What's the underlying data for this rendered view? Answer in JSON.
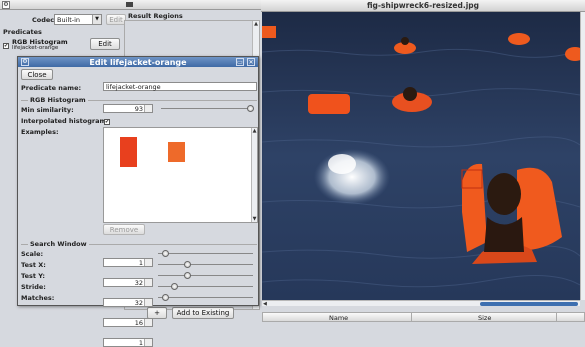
{
  "main_window": {
    "codec_label": "Codec",
    "codec_value": "Built-in",
    "edit_label": "Edit",
    "predicates_heading": "Predicates",
    "predicate_name": "RGB Histogram",
    "predicate_sub": "lifejacket-orange",
    "predicate_edit_label": "Edit",
    "result_regions_label": "Result Regions",
    "add_button_label": "+",
    "add_existing_label": "Add to Existing"
  },
  "dialog": {
    "title": "Edit lifejacket-orange",
    "close_label": "Close",
    "predicate_name_label": "Predicate name:",
    "predicate_name_value": "lifejacket-orange",
    "rgb_section": "RGB Histogram",
    "min_similarity_label": "Min similarity:",
    "min_similarity_value": "93",
    "interpolated_label": "Interpolated histogram:",
    "interpolated_checked": "✔",
    "examples_label": "Examples:",
    "remove_label": "Remove",
    "search_section": "Search Window",
    "params": [
      {
        "label": "Scale:",
        "value": "1",
        "level": 0.04
      },
      {
        "label": "Test X:",
        "value": "32",
        "level": 0.3
      },
      {
        "label": "Test Y:",
        "value": "32",
        "level": 0.3
      },
      {
        "label": "Stride:",
        "value": "16",
        "level": 0.15
      },
      {
        "label": "Matches:",
        "value": "1",
        "level": 0.04
      }
    ],
    "example_colors": [
      "#e8401e",
      "#ee6a2a"
    ]
  },
  "image_window": {
    "title": "fig-shipwreck6-resized.jpg",
    "col_name": "Name",
    "col_size": "Size",
    "sea_color": "#2b3b5a",
    "jacket_color": "#ee5a1e"
  }
}
